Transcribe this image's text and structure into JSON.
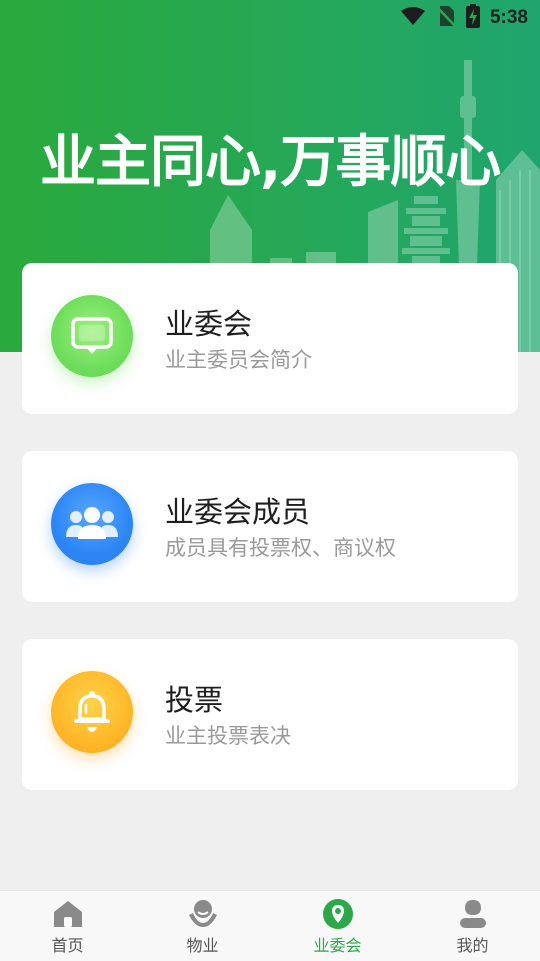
{
  "status_bar": {
    "time": "5:38",
    "icons": [
      "wifi-icon",
      "no-sim-icon",
      "battery-charging-icon"
    ]
  },
  "hero": {
    "headline": "业主同心,万事顺心"
  },
  "cards": [
    {
      "title": "业委会",
      "subtitle": "业主委员会简介",
      "icon": "chat-icon",
      "color": "#6fde5c"
    },
    {
      "title": "业委会成员",
      "subtitle": "成员具有投票权、商议权",
      "icon": "people-icon",
      "color": "#2d86f5"
    },
    {
      "title": "投票",
      "subtitle": "业主投票表决",
      "icon": "bell-icon",
      "color": "#ffb829"
    }
  ],
  "tabbar": {
    "active_color": "#2aa84a",
    "items": [
      {
        "label": "首页",
        "icon": "home-icon",
        "active": false
      },
      {
        "label": "物业",
        "icon": "property-icon",
        "active": false
      },
      {
        "label": "业委会",
        "icon": "location-pin-icon",
        "active": true
      },
      {
        "label": "我的",
        "icon": "user-icon",
        "active": false
      }
    ]
  }
}
